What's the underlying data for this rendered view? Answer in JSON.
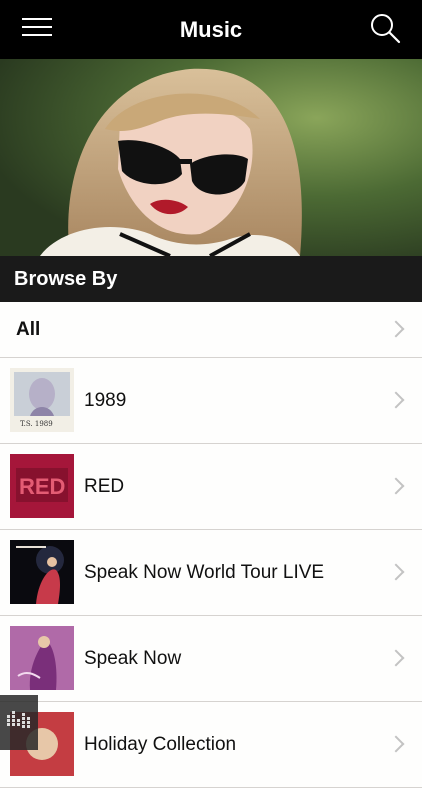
{
  "header": {
    "title": "Music",
    "menu_icon": "hamburger-menu-icon",
    "search_icon": "search-icon"
  },
  "hero": {
    "description_icon": "artist-photo"
  },
  "browse": {
    "title": "Browse By"
  },
  "items": [
    {
      "label": "All"
    },
    {
      "label": "1989",
      "art_text": "T.S.   1989"
    },
    {
      "label": "RED",
      "art_text": "RED"
    },
    {
      "label": "Speak Now World Tour LIVE"
    },
    {
      "label": "Speak Now"
    },
    {
      "label": "Holiday Collection"
    }
  ],
  "colors": {
    "navbar": "#000000",
    "section_header": "#1a1a1a",
    "chevron": "#c3c3c3"
  }
}
